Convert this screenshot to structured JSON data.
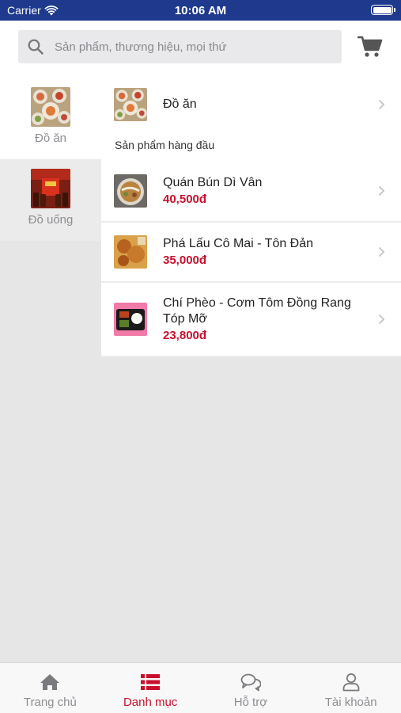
{
  "status_bar": {
    "carrier": "Carrier",
    "time": "10:06 AM"
  },
  "search": {
    "placeholder": "Sản phẩm, thương hiệu, mọi thứ"
  },
  "sidebar": {
    "items": [
      {
        "label": "Đồ ăn",
        "active": true
      },
      {
        "label": "Đồ uống",
        "active": false
      }
    ]
  },
  "content": {
    "category": {
      "name": "Đồ ăn"
    },
    "section_title": "Sản phẩm hàng đầu",
    "products": [
      {
        "name": "Quán Bún Dì Vân",
        "price": "40,500đ"
      },
      {
        "name": "Phá Lấu Cô Mai - Tôn Đản",
        "price": "35,000đ"
      },
      {
        "name": "Chí Phèo - Cơm Tôm Đồng Rang Tóp Mỡ",
        "price": "23,800đ"
      }
    ]
  },
  "tabbar": {
    "tabs": [
      {
        "label": "Trang chủ",
        "icon": "home-icon"
      },
      {
        "label": "Danh mục",
        "icon": "list-icon",
        "active": true
      },
      {
        "label": "Hỗ trợ",
        "icon": "chat-icon"
      },
      {
        "label": "Tài khoản",
        "icon": "user-icon"
      }
    ]
  },
  "colors": {
    "accent": "#c8102e",
    "status_bar": "#1f3a8c"
  }
}
